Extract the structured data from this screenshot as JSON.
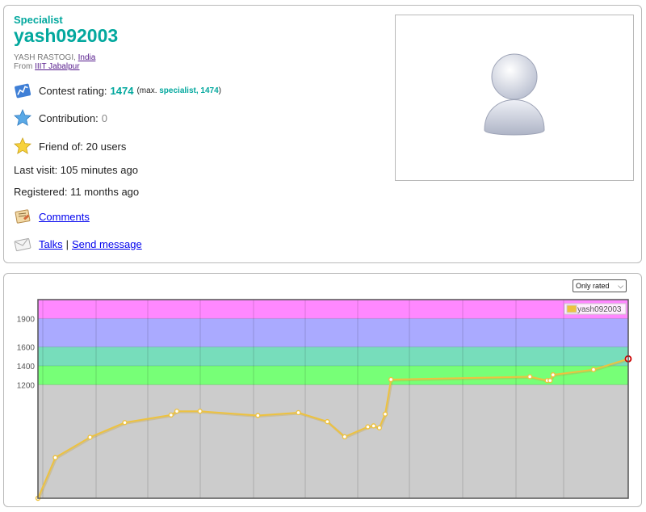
{
  "profile": {
    "rank": "Specialist",
    "handle": "yash092003",
    "name": "YASH RASTOGI,",
    "country": "India",
    "from_prefix": "From",
    "organization": "IIIT Jabalpur",
    "rating_label": "Contest rating:",
    "rating_value": "1474",
    "max_prefix": "(max.",
    "max_rank": "specialist,",
    "max_value": "1474",
    "max_suffix": ")",
    "contribution_label": "Contribution:",
    "contribution_value": "0",
    "friends_text": "Friend of: 20 users",
    "last_visit": "Last visit: 105 minutes ago",
    "registered": "Registered: 11 months ago",
    "comments_link": "Comments",
    "talks_link": "Talks",
    "separator": "|",
    "send_message_link": "Send message",
    "colors": {
      "specialist": "#03a89e",
      "link": "#0000ee"
    },
    "icons": [
      "rating-chart-icon",
      "contribution-star-icon",
      "friend-star-icon",
      "comments-icon",
      "talks-icon",
      "avatar-placeholder-icon"
    ]
  },
  "graph": {
    "filter_selected": "Only rated",
    "legend": "yash092003"
  },
  "chart_data": {
    "type": "line",
    "series": [
      {
        "name": "yash092003",
        "color": "#edc240",
        "x": [
          0,
          1,
          2,
          3,
          4,
          5,
          6,
          7,
          8,
          9,
          10,
          11,
          12,
          13,
          14,
          15,
          16,
          17,
          18,
          19,
          20,
          21,
          22,
          23,
          24
        ],
        "y": [
          0,
          430,
          645,
          800,
          880,
          920,
          920,
          875,
          905,
          810,
          650,
          755,
          765,
          745,
          890,
          1255,
          1285,
          1245,
          1245,
          1305,
          1360,
          1474,
          1474,
          1474,
          1474
        ]
      }
    ],
    "x": [
      0,
      3,
      9,
      15,
      23,
      24,
      28,
      38,
      45,
      50,
      53,
      57,
      58,
      59,
      60,
      61,
      85,
      88,
      88.5,
      89,
      96,
      102
    ],
    "y": [
      0,
      430,
      645,
      800,
      880,
      920,
      920,
      875,
      905,
      810,
      650,
      755,
      765,
      745,
      890,
      1255,
      1285,
      1245,
      1245,
      1305,
      1360,
      1474
    ],
    "ylim": [
      0,
      2100
    ],
    "yticks": [
      1200,
      1400,
      1600,
      1900
    ],
    "bands": [
      {
        "from": 0,
        "to": 1200,
        "color": "#cccccc"
      },
      {
        "from": 1200,
        "to": 1400,
        "color": "#77ff77"
      },
      {
        "from": 1400,
        "to": 1600,
        "color": "#77ddbb"
      },
      {
        "from": 1600,
        "to": 1900,
        "color": "#aaaaff"
      },
      {
        "from": 1900,
        "to": 2100,
        "color": "#ff88ff"
      }
    ],
    "grid": true,
    "legend_position": "top-right"
  }
}
